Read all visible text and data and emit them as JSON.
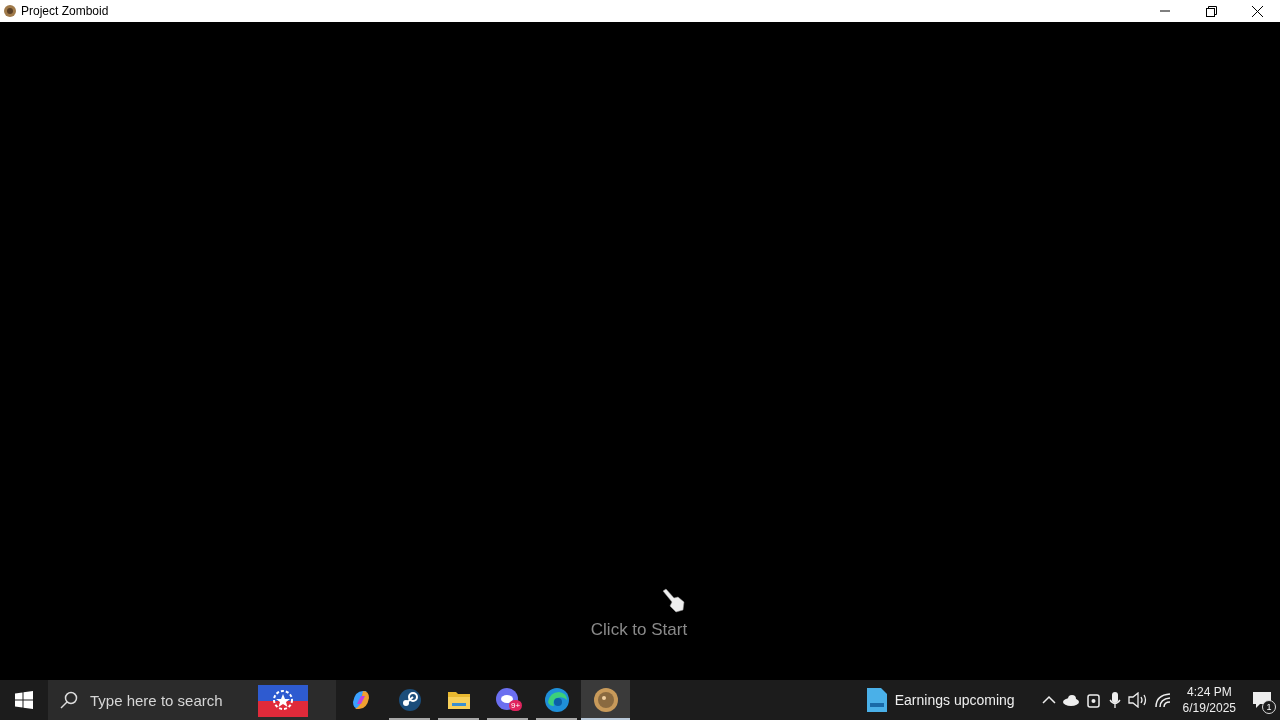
{
  "window": {
    "title": "Project Zomboid"
  },
  "game": {
    "prompt": "Click to Start"
  },
  "taskbar": {
    "search": {
      "placeholder": "Type here to search"
    },
    "apps": [
      {
        "kind": "copilot",
        "running": false,
        "selected": false
      },
      {
        "kind": "steam",
        "running": true,
        "selected": false
      },
      {
        "kind": "folder",
        "running": true,
        "selected": false
      },
      {
        "kind": "chat",
        "running": true,
        "selected": false,
        "badge": "9+"
      },
      {
        "kind": "browser",
        "running": true,
        "selected": false
      },
      {
        "kind": "game",
        "running": true,
        "selected": true
      }
    ],
    "widget": {
      "label": "Earnings upcoming"
    },
    "clock": {
      "time": "4:24 PM",
      "date": "6/19/2025"
    },
    "notifications": {
      "count": "1"
    }
  }
}
